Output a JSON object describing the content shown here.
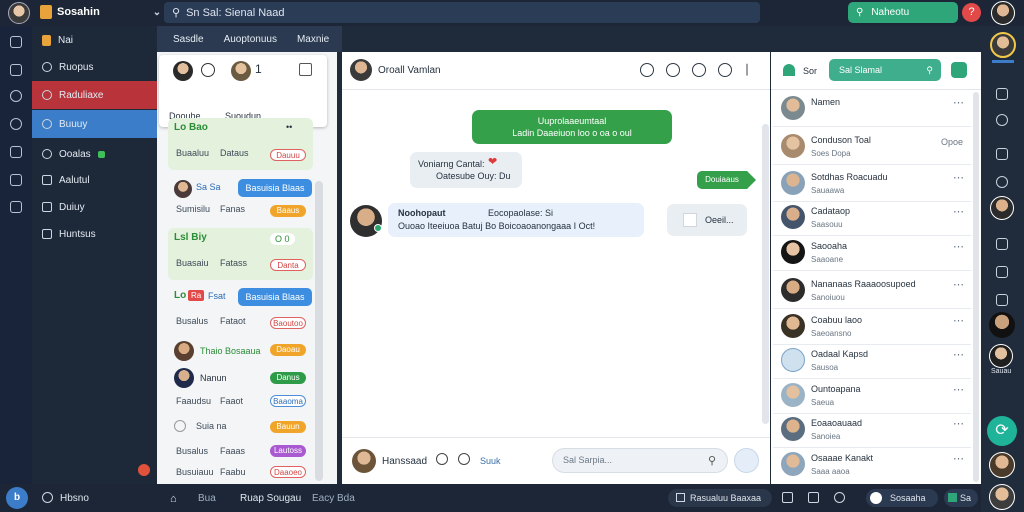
{
  "topbar": {
    "brand": "Sosahin",
    "search": "Sn Sal: Sienal Naad",
    "cta": "Naheotu",
    "close": "?"
  },
  "nav": {
    "items": [
      "Nai",
      "Ruopus",
      "Raduliaxe",
      "Buuuy",
      "Ooalas",
      "Aalutul",
      "Duiuy",
      "Huntsus"
    ],
    "bottom": "Hbsno"
  },
  "contacts": {
    "tabs": [
      "Sasdle",
      "Auoptonuus",
      "Maxnie"
    ],
    "card": {
      "name_a": "Doouhe",
      "name_b": "Suoudun",
      "count": "1"
    },
    "items": [
      {
        "name": "Lo Bao",
        "sub1": "Buaaluu",
        "sub2": "Dataus",
        "pill": "Dauuu"
      },
      {
        "name": "Sa Sa",
        "sub1": "Sumisilu",
        "sub2": "Fanas",
        "pill": "Baaus",
        "bubble": "Basuisia Blaas"
      },
      {
        "name": "Lsl Biy",
        "sub1": "Buasaiu",
        "sub2": "Fatass",
        "pill": "Danta",
        "badge": "O 0"
      },
      {
        "name": "Lo",
        "tag": "Ra",
        "name2": "Fsat",
        "sub1": "Busalus",
        "sub2": "Fataot",
        "pill": "Baoutoo",
        "bubble": "Basuisia Blaas"
      },
      {
        "name": "Thaio Bosaaua",
        "sub1": "",
        "sub2": "",
        "pill": "Daoau"
      },
      {
        "name": "Nanun",
        "sub1": "",
        "sub2": "",
        "pill": "Danus"
      },
      {
        "name": "Faaudsu",
        "sub1": "",
        "sub2": "Faaot",
        "pill": "Baaoma"
      },
      {
        "name": "Suia na",
        "sub1": "Busaiu",
        "sub2": "Fataus",
        "pill": "Bauun"
      },
      {
        "name": "",
        "sub1": "Busalus",
        "sub2": "Faaas",
        "pill": "Lautoss"
      },
      {
        "name": "",
        "sub1": "Busuiauu",
        "sub2": "Faabu",
        "pill": "Daaoeo"
      }
    ]
  },
  "chat": {
    "title": "Oroall Vamlan",
    "msg1_a": "Uuprolaaeumtaal",
    "msg1_b": "Ladin Daaeiuon loo o oa o oul",
    "msg2_a": "Voniarng Cantal:",
    "msg2_b": "Oatesube Ouy: Du",
    "msg3_name": "Noohopaut",
    "msg3_right": "Eocopaolase: Si",
    "msg3_body": "Ouoao Iteeiuoa Batuj Bo Boicoaoanongaaa I Oct!",
    "note": "Oeeil...",
    "tag": "Douiaaus",
    "footer_name": "Hanssaad",
    "footer_mid": "Suuk",
    "input": "Sal Sarpia..."
  },
  "right": {
    "label": "Sor",
    "search": "Sal Slamal",
    "rows": [
      {
        "name": "Namen",
        "sub": ""
      },
      {
        "name": "Conduson Toal",
        "sub": "Soes Dopa",
        "tail": "Opoe"
      },
      {
        "name": "Sotdhas Roacuadu",
        "sub": "Sauaawa",
        "tail": ""
      },
      {
        "name": "Cadataop",
        "sub": "Saasouu",
        "tail": ""
      },
      {
        "name": "Saooaha",
        "sub": "Saaoane",
        "tail": ""
      },
      {
        "name": "Nananaas Raaaoosupoed",
        "sub": "Sanoiuou",
        "tail": ""
      },
      {
        "name": "Coabuu laoo",
        "sub": "Saeoansno",
        "tail": ""
      },
      {
        "name": "Oadaal Kapsd",
        "sub": "Sausoa",
        "tail": ""
      },
      {
        "name": "Ountoapana",
        "sub": "Saeua",
        "tail": ""
      },
      {
        "name": "Eoaaoauaad",
        "sub": "Sanoiea",
        "tail": ""
      },
      {
        "name": "Osaaae Kanakt",
        "sub": "Saaa aaoa",
        "tail": ""
      }
    ]
  },
  "rail": {
    "user_label": "Sauau"
  },
  "bottom": {
    "a": "Bua",
    "b": "Ruap Sougau",
    "c": "Eacy Bda",
    "d": "Rasualuu Baaxaa",
    "e": "Sosaaha",
    "f": "Sa"
  },
  "colors": {
    "accent_green": "#35a04a",
    "accent_blue": "#3d8ee0",
    "nav_red": "#b8343a",
    "nav_blue": "#3b7dc8",
    "dark": "#1c2636"
  }
}
